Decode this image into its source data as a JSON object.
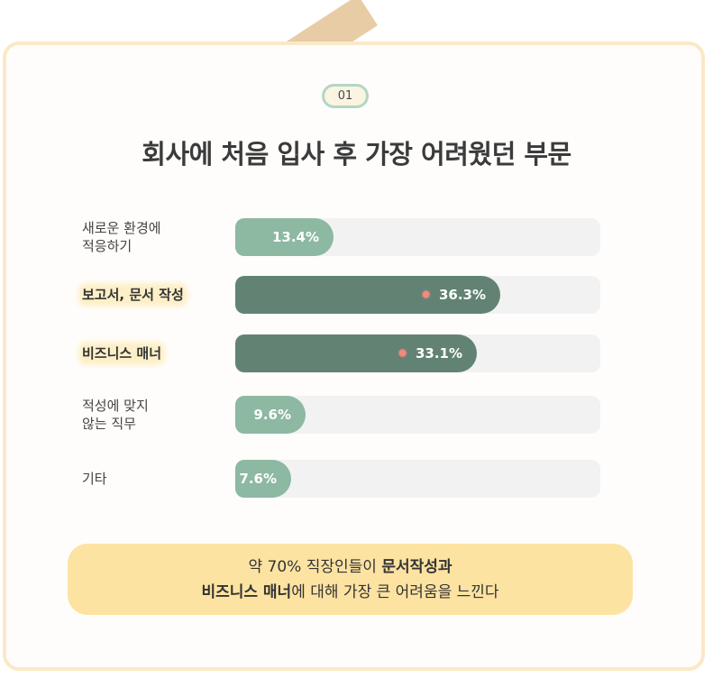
{
  "badge": "01",
  "title": "회사에 처음 입사 후 가장 어려웠던 부문",
  "chart_data": {
    "type": "bar",
    "orientation": "horizontal",
    "categories": [
      "새로운 환경에 적응하기",
      "보고서, 문서 작성",
      "비즈니스 매너",
      "적성에 맞지 않는 직무",
      "기타"
    ],
    "category_lines": [
      [
        "새로운 환경에",
        "적응하기"
      ],
      [
        "보고서, 문서 작성"
      ],
      [
        "비즈니스 매너"
      ],
      [
        "적성에 맞지",
        "않는 직무"
      ],
      [
        "기타"
      ]
    ],
    "values": [
      13.4,
      36.3,
      33.1,
      9.6,
      7.6
    ],
    "value_labels": [
      "13.4%",
      "36.3%",
      "33.1%",
      "9.6%",
      "7.6%"
    ],
    "highlighted": [
      false,
      true,
      true,
      false,
      false
    ],
    "xlim": [
      0,
      50
    ],
    "unit": "%",
    "colors": {
      "normal": "#8db8a2",
      "highlight": "#628373",
      "track": "#f2f2f2",
      "burst": "#f08b80"
    }
  },
  "note": {
    "line1_prefix": "약 70% 직장인들이 ",
    "line1_bold": "문서작성과",
    "line2_bold": "비즈니스 매너",
    "line2_suffix": "에 대해 가장 큰 어려움을 느낀다"
  }
}
